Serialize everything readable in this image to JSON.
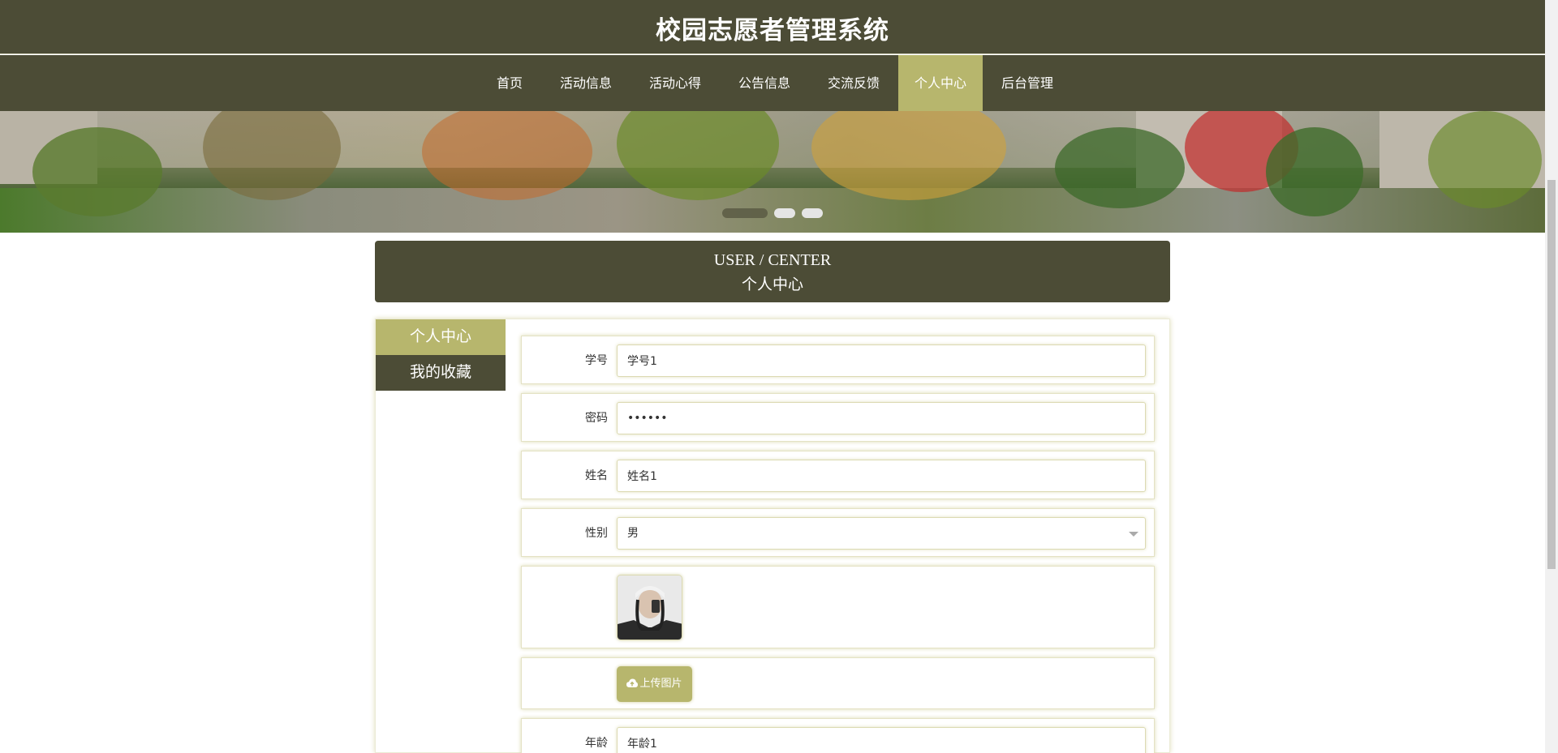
{
  "header": {
    "title": "校园志愿者管理系统"
  },
  "nav": {
    "items": [
      {
        "label": "首页"
      },
      {
        "label": "活动信息"
      },
      {
        "label": "活动心得"
      },
      {
        "label": "公告信息"
      },
      {
        "label": "交流反馈"
      },
      {
        "label": "个人中心",
        "active": true
      },
      {
        "label": "后台管理"
      }
    ]
  },
  "banner": {
    "slides": 3,
    "active_slide": 1
  },
  "section": {
    "title_en": "USER / CENTER",
    "title_zh": "个人中心"
  },
  "sidebar": {
    "items": [
      {
        "label": "个人中心",
        "active": true
      },
      {
        "label": "我的收藏"
      }
    ]
  },
  "form": {
    "student_id": {
      "label": "学号",
      "value": "学号1"
    },
    "password": {
      "label": "密码",
      "value": "••••••"
    },
    "name": {
      "label": "姓名",
      "value": "姓名1"
    },
    "gender": {
      "label": "性别",
      "value": "男"
    },
    "upload_button": "上传图片",
    "age": {
      "label": "年龄",
      "value": "年龄1"
    }
  },
  "colors": {
    "primary": "#4c4c36",
    "accent": "#b7b66d"
  }
}
